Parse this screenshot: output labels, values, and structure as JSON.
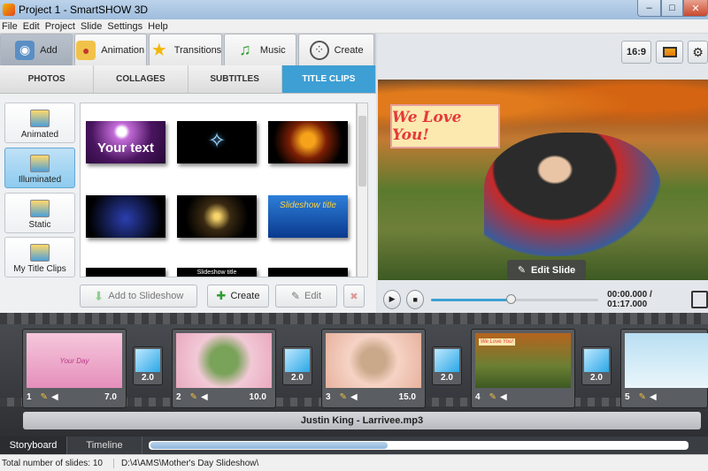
{
  "window": {
    "title": "Project 1 - SmartSHOW 3D",
    "min": "–",
    "max": "□",
    "close": "✕"
  },
  "menu": [
    "File",
    "Edit",
    "Project",
    "Slide",
    "Settings",
    "Help"
  ],
  "top_tabs": [
    {
      "label": "Add",
      "icon": "camera-icon"
    },
    {
      "label": "Animation",
      "icon": "palette-icon"
    },
    {
      "label": "Transitions",
      "icon": "star-icon"
    },
    {
      "label": "Music",
      "icon": "music-note-icon"
    },
    {
      "label": "Create",
      "icon": "film-reel-icon"
    }
  ],
  "sub_tabs": [
    "PHOTOS",
    "COLLAGES",
    "SUBTITLES",
    "TITLE CLIPS"
  ],
  "categories": [
    "Animated",
    "Illuminated",
    "Static",
    "My Title Clips"
  ],
  "thumb_texts": {
    "your_text": "Your text",
    "slideshow_title": "Slideshow title",
    "slideshow_title_small": "Slideshow title"
  },
  "actions": {
    "add": "Add to Slideshow",
    "create": "Create",
    "edit": "Edit"
  },
  "toolbar": {
    "aspect": "16:9"
  },
  "preview": {
    "banner": "We Love You!",
    "edit_slide": "Edit Slide"
  },
  "player": {
    "time": "00:00.000 / 01:17.000",
    "progress": 0.43
  },
  "slides": [
    {
      "num": "1",
      "dur": "7.0",
      "text": "Your Day"
    },
    {
      "num": "2",
      "dur": "10.0"
    },
    {
      "num": "3",
      "dur": "15.0"
    },
    {
      "num": "4",
      "dur": "",
      "text": "We Love You!"
    },
    {
      "num": "5",
      "dur": ""
    }
  ],
  "transitions": [
    "2.0",
    "2.0",
    "2.0",
    "2.0"
  ],
  "audio": "Justin King - Larrivee.mp3",
  "bottom_tabs": [
    "Storyboard",
    "Timeline"
  ],
  "status": {
    "count": "Total number of slides: 10",
    "path": "D:\\4\\AMS\\Mother's Day Slideshow\\"
  },
  "colors": {
    "accent": "#3d9fd4",
    "storyboard": "#3a3d42"
  }
}
